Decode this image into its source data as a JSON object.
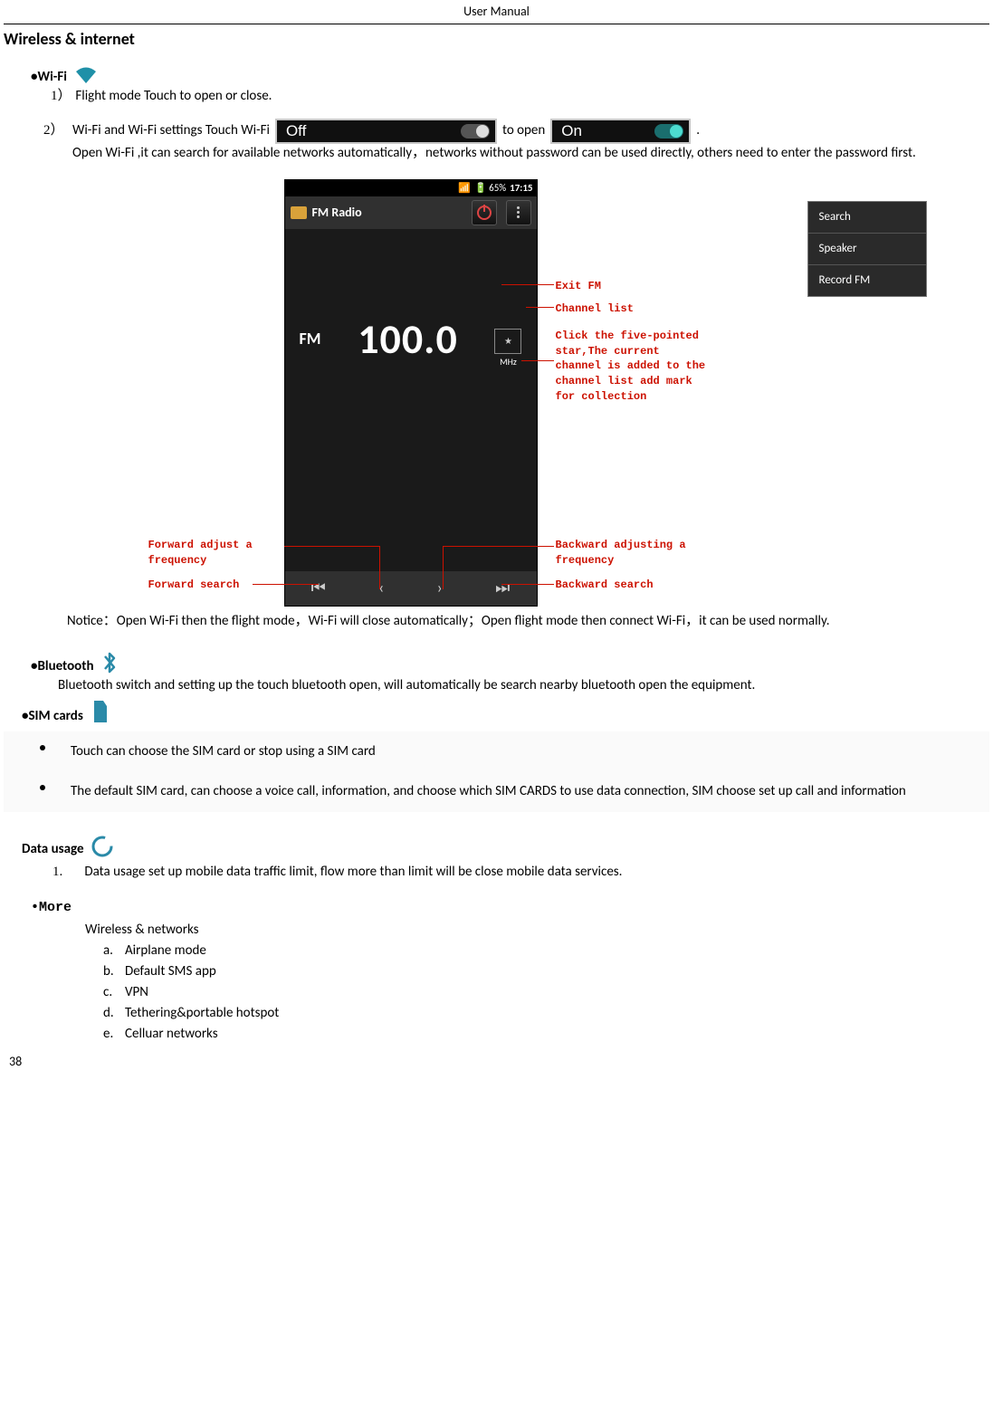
{
  "header": "User    Manual",
  "title": "Wireless & internet",
  "wifi": {
    "heading": "•Wi-Fi",
    "item1_marker": "1）",
    "item1_text": "Flight mode      Touch to open or close.",
    "item2_marker": "2）",
    "item2_a": "Wi-Fi and Wi-Fi settings       Touch Wi-Fi",
    "toggle_off": "Off",
    "item2_b": "to open",
    "toggle_on": "On",
    "item2_c": ".",
    "item2_para": "Open Wi-Fi ,it can search for available networks automatically，networks without password can be used directly, others need to enter the password first."
  },
  "figure": {
    "status_signal": "65%",
    "status_time": "17:15",
    "app_title": "FM Radio",
    "menu": {
      "a": "Search",
      "b": "Speaker",
      "c": "Record FM"
    },
    "fm_label": "FM",
    "freq": "100.0",
    "mhz": "MHz",
    "callouts": {
      "exit": "Exit FM",
      "channel": "Channel list",
      "star": "Click the five-pointed star,The current channel is added to the channel list add mark for collection",
      "fwd_adj": "Forward adjust a frequency",
      "fwd_search": "Forward search",
      "bwd_adj": "Backward adjusting a frequency",
      "bwd_search": "Backward search"
    }
  },
  "notice": "Notice：Open Wi-Fi then the flight mode，Wi-Fi will close automatically；Open flight mode then connect Wi-Fi，it can be used normally.",
  "bluetooth": {
    "heading": "•Bluetooth",
    "para": "Bluetooth switch and setting up the touch bluetooth open, will automatically be search nearby bluetooth open the equipment."
  },
  "sim": {
    "heading": "•SIM cards",
    "b1": "Touch can choose the SIM card or stop using a SIM card",
    "b2": "The default SIM card, can choose a voice call, information, and choose which SIM CARDS to use data connection, SIM choose set up call and information"
  },
  "datausage": {
    "heading": "Data usage",
    "marker": "1.",
    "text": "Data usage   set up mobile data traffic limit, flow more than limit will be close mobile data services."
  },
  "more": {
    "heading": "•More",
    "sub": "Wireless & networks",
    "a": {
      "m": "a.",
      "t": "Airplane mode"
    },
    "b": {
      "m": "b.",
      "t": "Default SMS app"
    },
    "c": {
      "m": "c.",
      "t": "VPN"
    },
    "d": {
      "m": "d.",
      "t": "Tethering&portable hotspot"
    },
    "e": {
      "m": "e.",
      "t": "Celluar networks"
    }
  },
  "page_num": "38"
}
